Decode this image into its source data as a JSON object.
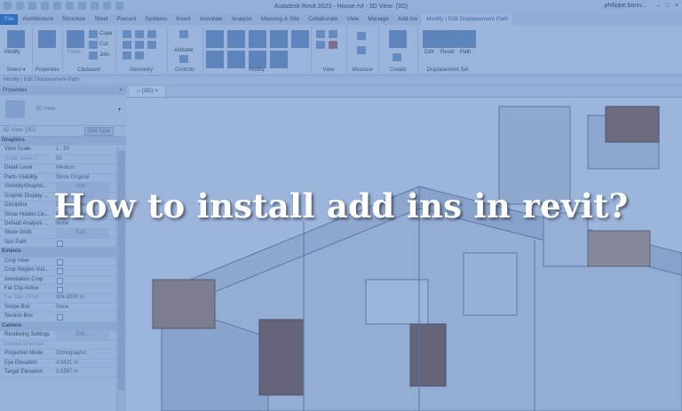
{
  "window": {
    "title": "Autodesk Revit 2023 - House.rvt - 3D View: {3D}",
    "user": "philippe.bonn..."
  },
  "tabs": [
    "File",
    "Architecture",
    "Structure",
    "Steel",
    "Precast",
    "Systems",
    "Insert",
    "Annotate",
    "Analyze",
    "Massing & Site",
    "Collaborate",
    "View",
    "Manage",
    "Add-Ins",
    "Modify | Edit Displacement Path"
  ],
  "active_tab_index": 14,
  "ribbon": {
    "modify_label": "Modify",
    "select_label": "Select ▾",
    "properties_label": "Properties",
    "clipboard": {
      "paste": "Paste",
      "cope": "Cope",
      "cut": "Cut",
      "join": "Join",
      "label": "Clipboard"
    },
    "geometry_label": "Geometry",
    "controls": {
      "activate": "Activate",
      "label": "Controls"
    },
    "modify_group_label": "Modify",
    "view_label": "View",
    "measure_label": "Measure",
    "create_label": "Create",
    "displacement": {
      "edit": "Edit",
      "reset": "Reset",
      "path": "Path",
      "label": "Displacement Set"
    }
  },
  "options_bar": "Modify | Edit Displacement Path",
  "properties": {
    "header": "Properties",
    "type_name": "3D View",
    "instance": "3D View: {3D}",
    "edit_type": "Edit Type",
    "rows": [
      {
        "cat": true,
        "k": "Graphics"
      },
      {
        "k": "View Scale",
        "v": "1 : 50"
      },
      {
        "k": "Scale Value 1:",
        "v": "50",
        "muted": true
      },
      {
        "k": "Detail Level",
        "v": "Medium"
      },
      {
        "k": "Parts Visibility",
        "v": "Show Original"
      },
      {
        "k": "Visibility/Graphic...",
        "btn": "Edit..."
      },
      {
        "k": "Graphic Display ...",
        "btn": "Edit..."
      },
      {
        "k": "Discipline",
        "v": "Coordination"
      },
      {
        "k": "Show Hidden Lin...",
        "v": "By Discipline"
      },
      {
        "k": "Default Analysis ...",
        "v": "None"
      },
      {
        "k": "Show Grids",
        "btn": "Edit..."
      },
      {
        "k": "Sun Path",
        "cb": true
      },
      {
        "cat": true,
        "k": "Extents"
      },
      {
        "k": "Crop View",
        "cb": true
      },
      {
        "k": "Crop Region Visi...",
        "cb": true
      },
      {
        "k": "Annotation Crop",
        "cb": true
      },
      {
        "k": "Far Clip Active",
        "cb": true
      },
      {
        "k": "Far Clip Offset",
        "v": "304.8000 m",
        "muted": true
      },
      {
        "k": "Scope Box",
        "v": "None"
      },
      {
        "k": "Section Box",
        "cb": true
      },
      {
        "cat": true,
        "k": "Camera"
      },
      {
        "k": "Rendering Settings",
        "btn": "Edit..."
      },
      {
        "k": "Locked Orientati...",
        "muted": true
      },
      {
        "k": "Projection Mode",
        "v": "Orthographic"
      },
      {
        "k": "Eye Elevation",
        "v": "4.9421 m"
      },
      {
        "k": "Target Elevation",
        "v": "0.5587 m"
      }
    ]
  },
  "view_tab": "{3D}",
  "headline": "How to install add ins in revit?",
  "colors": {
    "overlay": "#3a6ebe",
    "file_tab": "#2f6fbf",
    "headline": "#ffffff"
  }
}
